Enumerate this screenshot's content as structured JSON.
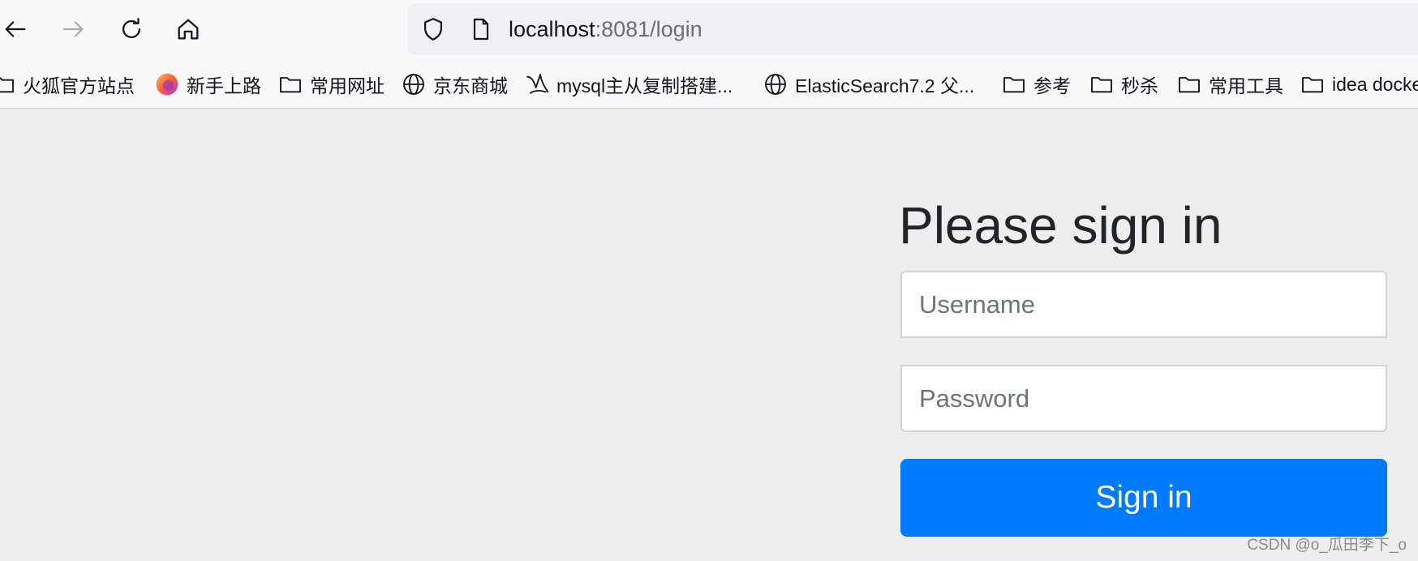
{
  "browser": {
    "url_host": "localhost",
    "url_path": ":8081/login",
    "bookmarks": [
      {
        "label": "火狐官方站点",
        "icon": "folder-icon"
      },
      {
        "label": "新手上路",
        "icon": "firefox-icon"
      },
      {
        "label": "常用网址",
        "icon": "folder-icon"
      },
      {
        "label": "京东商城",
        "icon": "globe-icon"
      },
      {
        "label": "mysql主从复制搭建...",
        "icon": "site-icon"
      },
      {
        "label": "ElasticSearch7.2 父...",
        "icon": "globe-icon"
      },
      {
        "label": "参考",
        "icon": "folder-icon"
      },
      {
        "label": "秒杀",
        "icon": "folder-icon"
      },
      {
        "label": "常用工具",
        "icon": "folder-icon"
      },
      {
        "label": "idea docke",
        "icon": "folder-icon"
      }
    ]
  },
  "login": {
    "heading": "Please sign in",
    "username_placeholder": "Username",
    "password_placeholder": "Password",
    "submit_label": "Sign in"
  },
  "colors": {
    "primary": "#007bff",
    "page_background": "#eeeeee",
    "heading_text": "#212529"
  },
  "watermark": "CSDN @o_瓜田李下_o"
}
